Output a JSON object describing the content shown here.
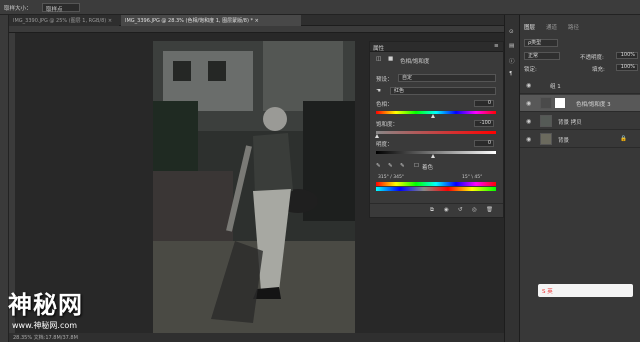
{
  "options": {
    "sample_label": "取样大小：",
    "sample_value": "取样点"
  },
  "tabs": [
    {
      "label": "IMG_3390.JPG @ 25% (图层 1, RGB/8)",
      "close": "×"
    },
    {
      "label": "IMG_3396.JPG @ 28.3% (色相/饱和度 1, 图层蒙版/8) *",
      "close": "×"
    }
  ],
  "status": {
    "text": "28.35%   文档:17.8M/37.8M"
  },
  "properties": {
    "title": "属性",
    "adj_name": "色相/饱和度",
    "preset_label": "预设：",
    "preset_value": "自定",
    "channel_value": "红色",
    "hue_label": "色相：",
    "hue_value": "0",
    "sat_label": "饱和度：",
    "sat_value": "-100",
    "light_label": "明度：",
    "light_value": "0",
    "colorize_label": "着色",
    "range_left": "315° / 345°",
    "range_right": "15° \\ 45°"
  },
  "layers": {
    "tabs": [
      "图层",
      "通道",
      "路径"
    ],
    "filter_label": "ρ类型",
    "blend": "正常",
    "opacity_label": "不透明度:",
    "opacity_value": "100%",
    "lock_label": "锁定:",
    "fill_label": "填充:",
    "fill_value": "100%",
    "items": [
      {
        "name": "组 1"
      },
      {
        "name": "色相/饱和度 3"
      },
      {
        "name": "背景 拷贝"
      },
      {
        "name": "背景"
      }
    ]
  },
  "watermark": {
    "main": "神秘网",
    "sub": "www.神秘网.com"
  },
  "ime": {
    "label": "S 英"
  }
}
